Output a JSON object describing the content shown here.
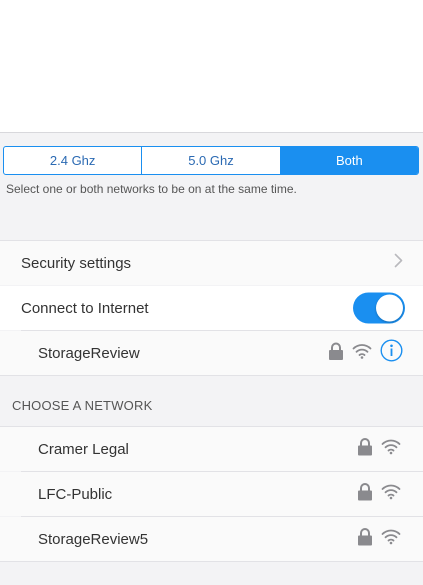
{
  "band_selector": {
    "options": [
      "2.4 Ghz",
      "5.0 Ghz",
      "Both"
    ],
    "selected": "Both"
  },
  "band_hint": "Select one or both networks to be on at the same time.",
  "settings": {
    "security_label": "Security settings",
    "internet_label": "Connect to Internet",
    "internet_enabled": true
  },
  "current_network": {
    "name": "StorageReview",
    "secured": true
  },
  "network_list": {
    "header": "CHOOSE A NETWORK",
    "items": [
      {
        "name": "Cramer Legal",
        "secured": true
      },
      {
        "name": "LFC-Public",
        "secured": true
      },
      {
        "name": "StorageReview5",
        "secured": true
      }
    ]
  },
  "colors": {
    "accent": "#1a8ff0",
    "background": "#f3f3f5",
    "row_background": "#fafafa",
    "icon_gray": "#8a8a8e"
  },
  "icons": {
    "security_row": "chevron-right-icon",
    "network_lock": "lock-icon",
    "network_signal": "wifi-icon",
    "network_info": "info-icon"
  }
}
